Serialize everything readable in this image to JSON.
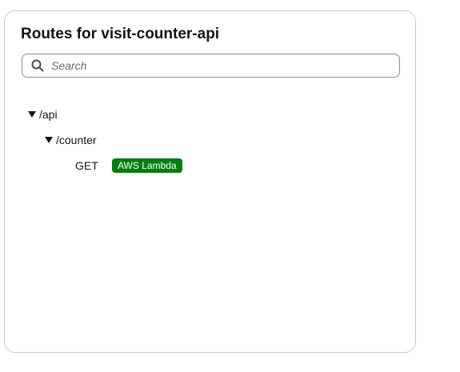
{
  "panel": {
    "title": "Routes for visit-counter-api"
  },
  "search": {
    "placeholder": "Search",
    "value": ""
  },
  "routes": {
    "api": {
      "label": "/api",
      "expanded": true
    },
    "counter": {
      "label": "/counter",
      "expanded": true
    },
    "method": {
      "label": "GET",
      "integration": "AWS Lambda",
      "integration_color": "#037f0c"
    }
  },
  "icons": {
    "search": "search-icon",
    "expand": "caret-down-icon"
  }
}
